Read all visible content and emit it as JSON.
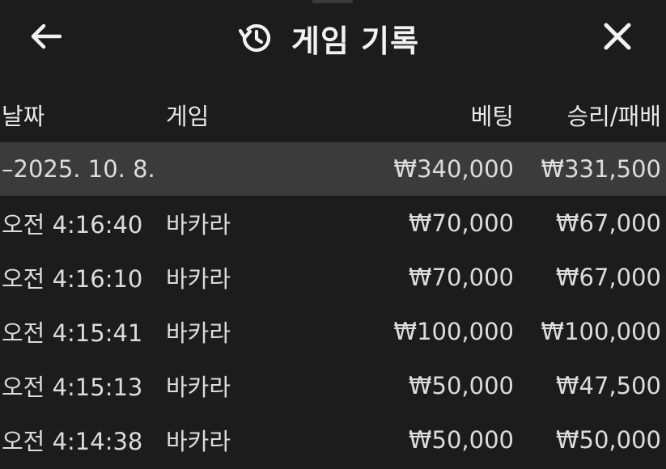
{
  "header": {
    "back_icon": "arrow-left-icon",
    "history_icon": "history-icon",
    "title": "게임 기록",
    "close_icon": "close-icon"
  },
  "table": {
    "columns": {
      "date": "날짜",
      "game": "게임",
      "bet": "베팅",
      "win_loss": "승리/패배"
    },
    "summary": {
      "date": "–2025. 10. 8.",
      "bet": "₩340,000",
      "win_loss": "₩331,500"
    },
    "rows": [
      {
        "time": "오전 4:16:40",
        "game": "바카라",
        "bet": "₩70,000",
        "win_loss": "₩67,000"
      },
      {
        "time": "오전 4:16:10",
        "game": "바카라",
        "bet": "₩70,000",
        "win_loss": "₩67,000"
      },
      {
        "time": "오전 4:15:41",
        "game": "바카라",
        "bet": "₩100,000",
        "win_loss": "₩100,000"
      },
      {
        "time": "오전 4:15:13",
        "game": "바카라",
        "bet": "₩50,000",
        "win_loss": "₩47,500"
      },
      {
        "time": "오전 4:14:38",
        "game": "바카라",
        "bet": "₩50,000",
        "win_loss": "₩50,000"
      }
    ]
  },
  "colors": {
    "background": "#1c1c1c",
    "summary_row": "#3b3b3b",
    "text": "#e6e6e6"
  }
}
